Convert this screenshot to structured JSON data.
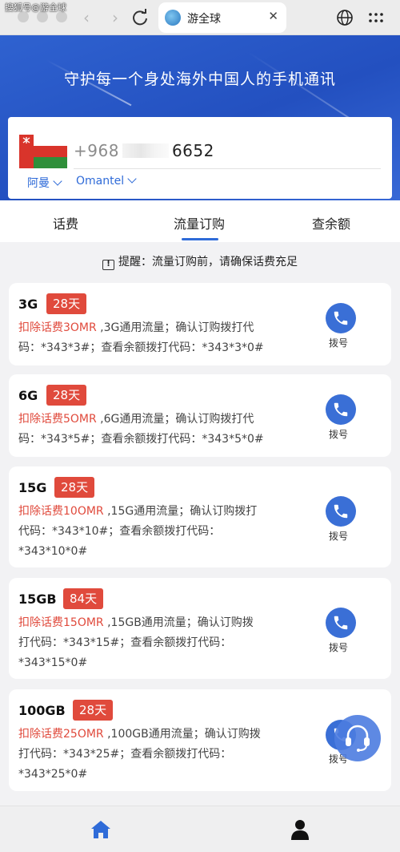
{
  "watermark": "搜狐号@游全球",
  "browser": {
    "tab_title": "游全球",
    "tab_close": "✕",
    "back_glyph": "‹",
    "forward_glyph": "›"
  },
  "hero": {
    "title": "守护每一个身处海外中国人的手机通讯"
  },
  "phone": {
    "prefix": "+968",
    "suffix": "6652",
    "country": "阿曼",
    "carrier": "Omantel"
  },
  "tabs": [
    {
      "label": "话费"
    },
    {
      "label": "流量订购",
      "active": true
    },
    {
      "label": "查余额"
    }
  ],
  "notice": {
    "icon": "!",
    "text": "提醒：流量订购前，请确保话费充足"
  },
  "plans": [
    {
      "name": "3G",
      "days": "28天",
      "fee": "扣除话费3OMR",
      "desc_line1": " ,3G通用流量；确认订购拨打代",
      "desc_rest": "码：*343*3#；查看余额拨打代码：*343*3*0#",
      "dial": "拨号"
    },
    {
      "name": "6G",
      "days": "28天",
      "fee": "扣除话费5OMR",
      "desc_line1": " ,6G通用流量；确认订购拨打代",
      "desc_rest": "码：*343*5#；查看余额拨打代码：*343*5*0#",
      "dial": "拨号"
    },
    {
      "name": "15G",
      "days": "28天",
      "fee": "扣除话费10OMR",
      "desc_line1": " ,15G通用流量；确认订购拨打",
      "desc_rest": "代码：*343*10#；查看余额拨打代码：",
      "desc_rest2": "*343*10*0#",
      "dial": "拨号"
    },
    {
      "name": "15GB",
      "days": "84天",
      "fee": "扣除话费15OMR",
      "desc_line1": " ,15GB通用流量；确认订购拨",
      "desc_rest": "打代码：*343*15#；查看余额拨打代码：",
      "desc_rest2": "*343*15*0#",
      "dial": "拨号"
    },
    {
      "name": "100GB",
      "days": "28天",
      "fee": "扣除话费25OMR",
      "desc_line1": " ,100GB通用流量；确认订购拨",
      "desc_rest": "打代码：*343*25#；查看余额拨打代码：",
      "desc_rest2": "*343*25*0#",
      "dial": "拨号"
    }
  ],
  "colors": {
    "accent": "#2f6bd8",
    "badge_red": "#e04a3c",
    "hero_blue": "#2350c0"
  },
  "icons": {
    "bottom_left": "home-icon",
    "bottom_right": "user-icon",
    "floating": "headset-icon"
  }
}
